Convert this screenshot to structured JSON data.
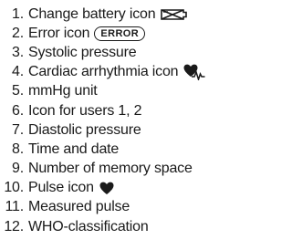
{
  "legend": {
    "items": [
      {
        "number": "1.",
        "text": "Change battery icon",
        "icon": "battery-icon"
      },
      {
        "number": "2.",
        "text": "Error icon",
        "badge": "ERROR"
      },
      {
        "number": "3.",
        "text": "Systolic pressure"
      },
      {
        "number": "4.",
        "text": "Cardiac arrhythmia icon",
        "icon": "heart-arrhythmia-icon"
      },
      {
        "number": "5.",
        "text": "mmHg unit"
      },
      {
        "number": "6.",
        "text": "Icon for users 1, 2"
      },
      {
        "number": "7.",
        "text": "Diastolic pressure"
      },
      {
        "number": "8.",
        "text": "Time and date"
      },
      {
        "number": "9.",
        "text": "Number of memory space"
      },
      {
        "number": "10.",
        "text": "Pulse icon",
        "icon": "heart-icon"
      },
      {
        "number": "11.",
        "text": "Measured pulse"
      },
      {
        "number": "12.",
        "text": "WHO-classification"
      }
    ]
  }
}
